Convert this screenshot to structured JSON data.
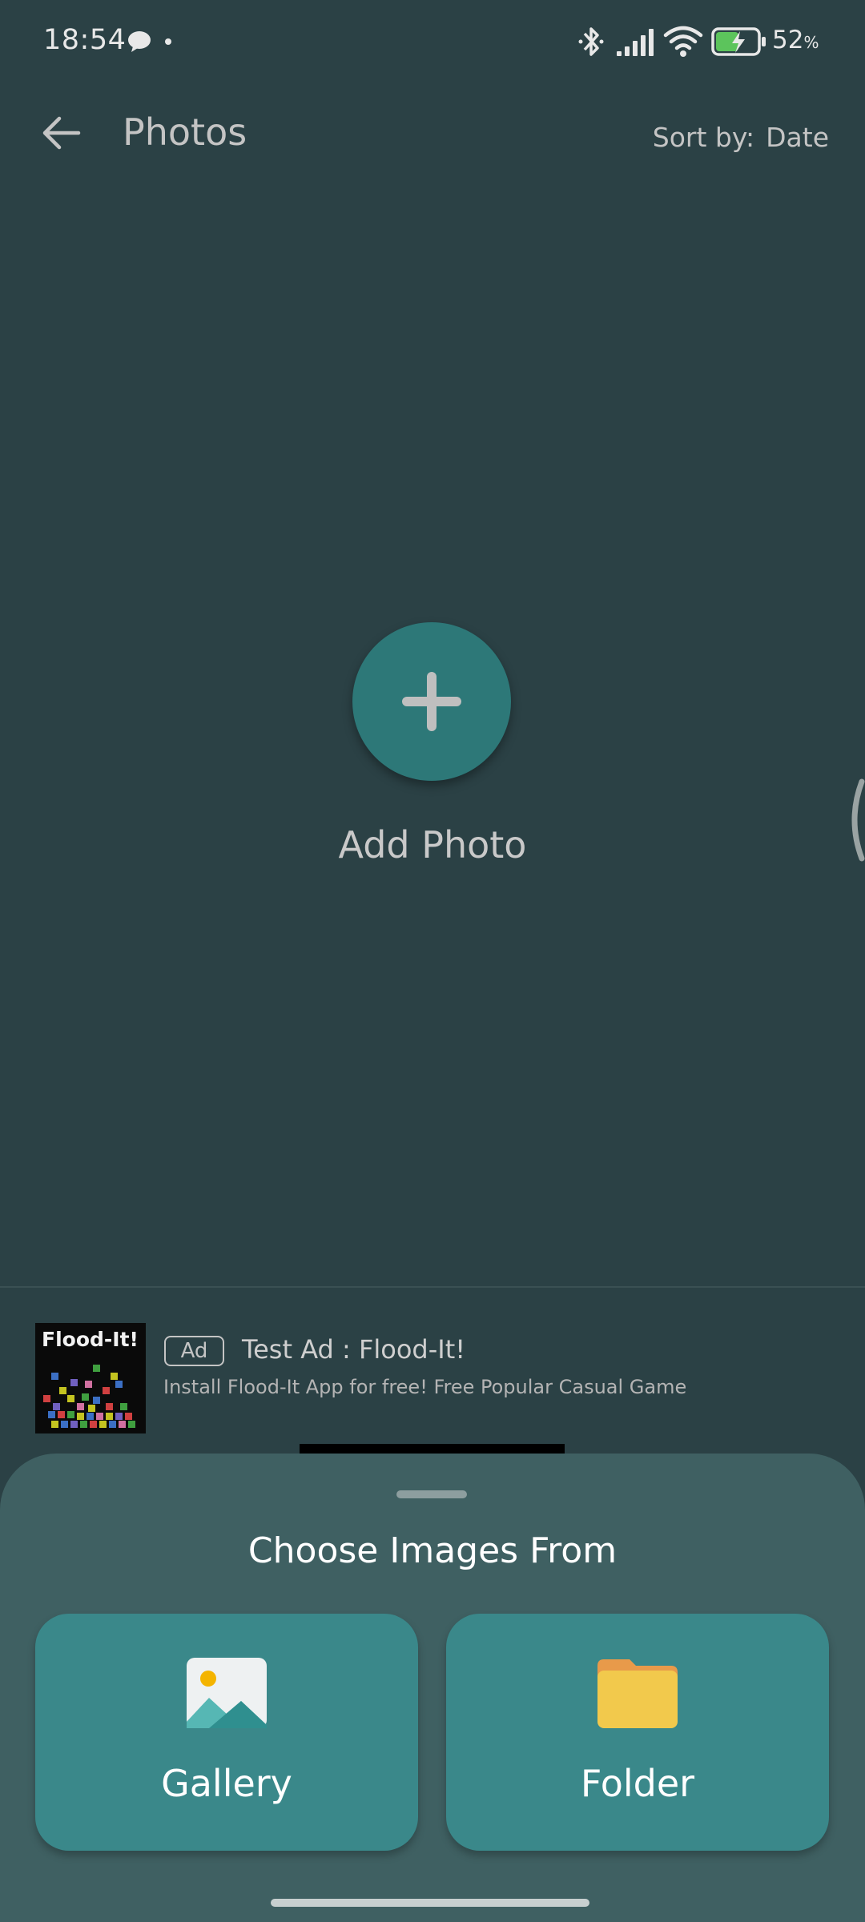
{
  "status_bar": {
    "time": "18:54",
    "battery_percent": "52",
    "battery_unit": "%",
    "icons": [
      "chat-bubble-icon",
      "dot-icon",
      "bluetooth-icon",
      "signal-icon",
      "wifi-icon",
      "battery-charging-icon"
    ]
  },
  "app_bar": {
    "title": "Photos",
    "sort_label": "Sort by:",
    "sort_value": "Date"
  },
  "empty_state": {
    "add_label": "Add Photo"
  },
  "ad": {
    "thumb_title": "Flood-It!",
    "badge": "Ad",
    "title": "Test Ad : Flood-It!",
    "description": "Install Flood-It App for free! Free Popular Casual Game"
  },
  "sheet": {
    "title": "Choose Images From",
    "options": [
      {
        "label": "Gallery",
        "icon": "gallery-icon"
      },
      {
        "label": "Folder",
        "icon": "folder-icon"
      }
    ]
  },
  "colors": {
    "background": "#2b4145",
    "accent": "#2d7878",
    "sheet": "#3f6062",
    "card": "#3a888a",
    "folder": "#f2c94c",
    "sun": "#f4b400"
  }
}
